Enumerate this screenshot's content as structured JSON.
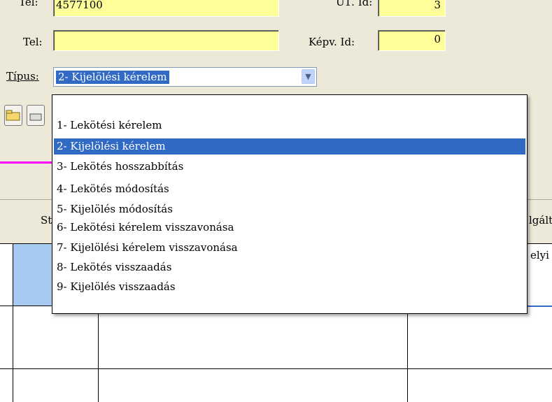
{
  "form": {
    "tel1_label": "Tel:",
    "tel1_value": "4577100",
    "tel2_label": "Tel:",
    "tel2_value": "",
    "u1_label": "Ü1. Id:",
    "u1_value": "3",
    "kepv_label": "Képv. Id:",
    "kepv_value": "0",
    "tipus_label": "Típus:",
    "tipus_value": "2- Kijelölési kérelem"
  },
  "grid": {
    "col_st_label": "St",
    "col_right_label": "lgált",
    "cell_right_value": "elyi"
  },
  "dropdown": {
    "options": [
      "",
      "1- Lekötési kérelem",
      "2- Kijelölési kérelem",
      "3- Lekötés hosszabbítás",
      "4- Lekötés módosítás",
      "5- Kijelölés módosítás",
      "6- Lekötési kérelem visszavonása",
      "7- Kijelölési kérelem visszavonása",
      "8- Lekötés visszaadás",
      "9- Kijelölés visszaadás"
    ],
    "selected_index": 2
  },
  "colors": {
    "field_bg": "#ffff99",
    "selection": "#316ac5",
    "accent_line": "#ff00ff"
  }
}
